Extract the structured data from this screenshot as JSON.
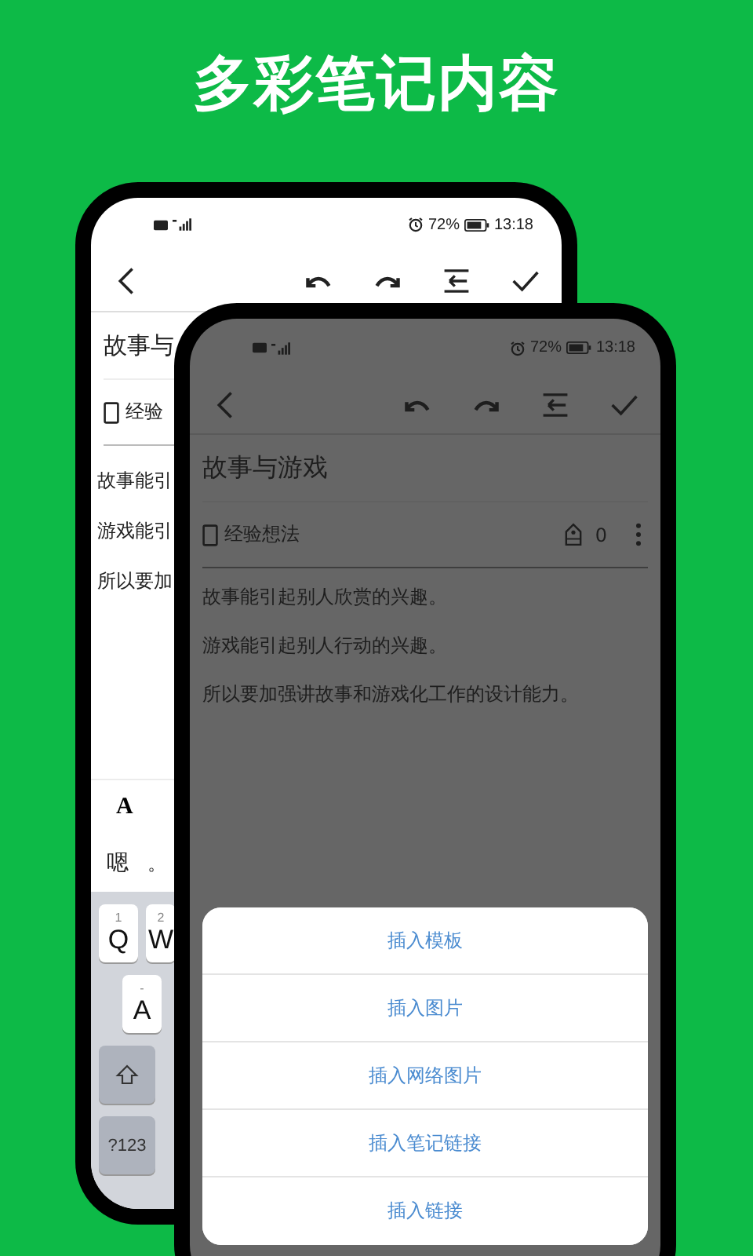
{
  "headline": "多彩笔记内容",
  "back_phone": {
    "status_bar": {
      "battery": "72%",
      "time": "13:18"
    },
    "title": "故事与",
    "notebook": "经验",
    "lines": [
      "故事能引",
      "游戏能引",
      "所以要加"
    ],
    "format_bar": {
      "button": "A"
    },
    "candidates": [
      "嗯",
      "。"
    ],
    "keyboard": {
      "row_1": [
        {
          "hint": "1",
          "label": "Q"
        },
        {
          "hint": "2",
          "label": "W"
        }
      ],
      "row_2": [
        {
          "hint": "-",
          "label": "A"
        }
      ],
      "symbols_key": "?123"
    }
  },
  "front_phone": {
    "status_bar": {
      "battery": "72%",
      "time": "13:18"
    },
    "title": "故事与游戏",
    "notebook": "经验想法",
    "tag_count": "0",
    "lines": [
      "故事能引起别人欣赏的兴趣。",
      "游戏能引起别人行动的兴趣。",
      "所以要加强讲故事和游戏化工作的设计能力。"
    ],
    "sheet": {
      "items": [
        "插入模板",
        "插入图片",
        "插入网络图片",
        "插入笔记链接",
        "插入链接"
      ]
    }
  }
}
